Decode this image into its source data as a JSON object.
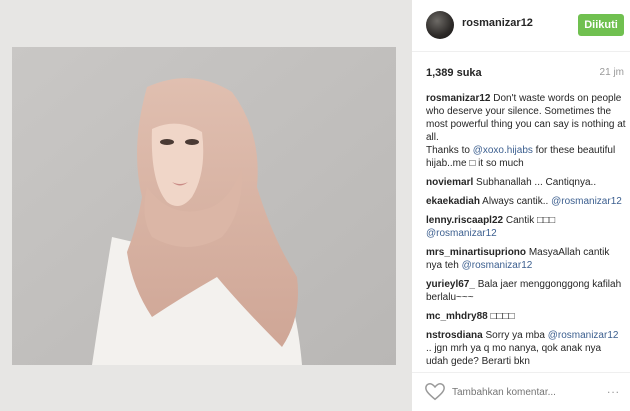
{
  "post": {
    "username": "rosmanizar12",
    "follow_label": "Diikuti",
    "likes": "1,389 suka",
    "time": "21 jm"
  },
  "caption": {
    "user": "rosmanizar12",
    "line1": "Don't waste words on people who deserve your silence. Sometimes the most powerful thing you can say is nothing at all.",
    "thanks_pre": "Thanks to",
    "mention": "@xoxo.hijabs",
    "thanks_post": "for these beautiful hijab..me □ it so much"
  },
  "comments": [
    {
      "user": "noviemarl",
      "text": "Subhanallah ... Cantiqnya..",
      "mention": ""
    },
    {
      "user": "ekaekadiah",
      "text": "Always cantik..",
      "mention": "@rosmanizar12"
    },
    {
      "user": "lenny.riscaapl22",
      "text": "Cantik □□□",
      "mention": "@rosmanizar12"
    },
    {
      "user": "mrs_minartisupriono",
      "text": "MasyaAllah cantik nya teh",
      "mention": "@rosmanizar12"
    },
    {
      "user": "yurieyl67_",
      "text": "Bala jaer menggonggong kafilah berlalu~~~",
      "mention": ""
    },
    {
      "user": "mc_mhdry88",
      "text": "□□□□",
      "mention": ""
    },
    {
      "user": "nstrosdiana",
      "text": "Sorry ya mba",
      "mention": "@rosmanizar12",
      "text2": ".. jgn mrh ya q mo nanya, qok anak nya udah gede? Berarti bkn"
    }
  ],
  "footer": {
    "placeholder": "Tambahkan komentar...",
    "more": "..."
  },
  "colors": {
    "follow_button": "#70c050",
    "mention": "#3c5f8f",
    "hijab": "#d9b4a5"
  },
  "icons": {
    "like": "heart-icon",
    "more": "more-options-icon"
  }
}
